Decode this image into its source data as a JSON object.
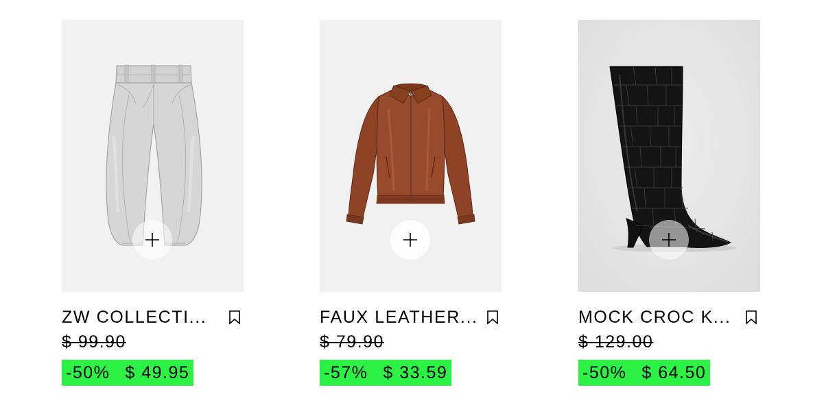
{
  "products": [
    {
      "title": "ZW COLLECTI...",
      "original_price": "$ 99.90",
      "discount": "-50%",
      "sale_price": "$ 49.95",
      "image_icon": "light-grey-barrel-jeans",
      "image_bg": "#f1f1f1"
    },
    {
      "title": "FAUX LEATHER...",
      "original_price": "$ 79.90",
      "discount": "-57%",
      "sale_price": "$ 33.59",
      "image_icon": "brown-faux-leather-bomber-jacket",
      "image_bg": "#f1f1f1"
    },
    {
      "title": "MOCK CROC K...",
      "original_price": "$ 129.00",
      "discount": "-50%",
      "sale_price": "$ 64.50",
      "image_icon": "black-croc-knee-high-boot",
      "image_bg": "#e7e7e7"
    }
  ],
  "colors": {
    "sale_badge": "#2bf244",
    "text": "#000000",
    "image_background": "#f1f1f1"
  },
  "icons": {
    "add": "plus-icon",
    "save": "bookmark-icon"
  }
}
